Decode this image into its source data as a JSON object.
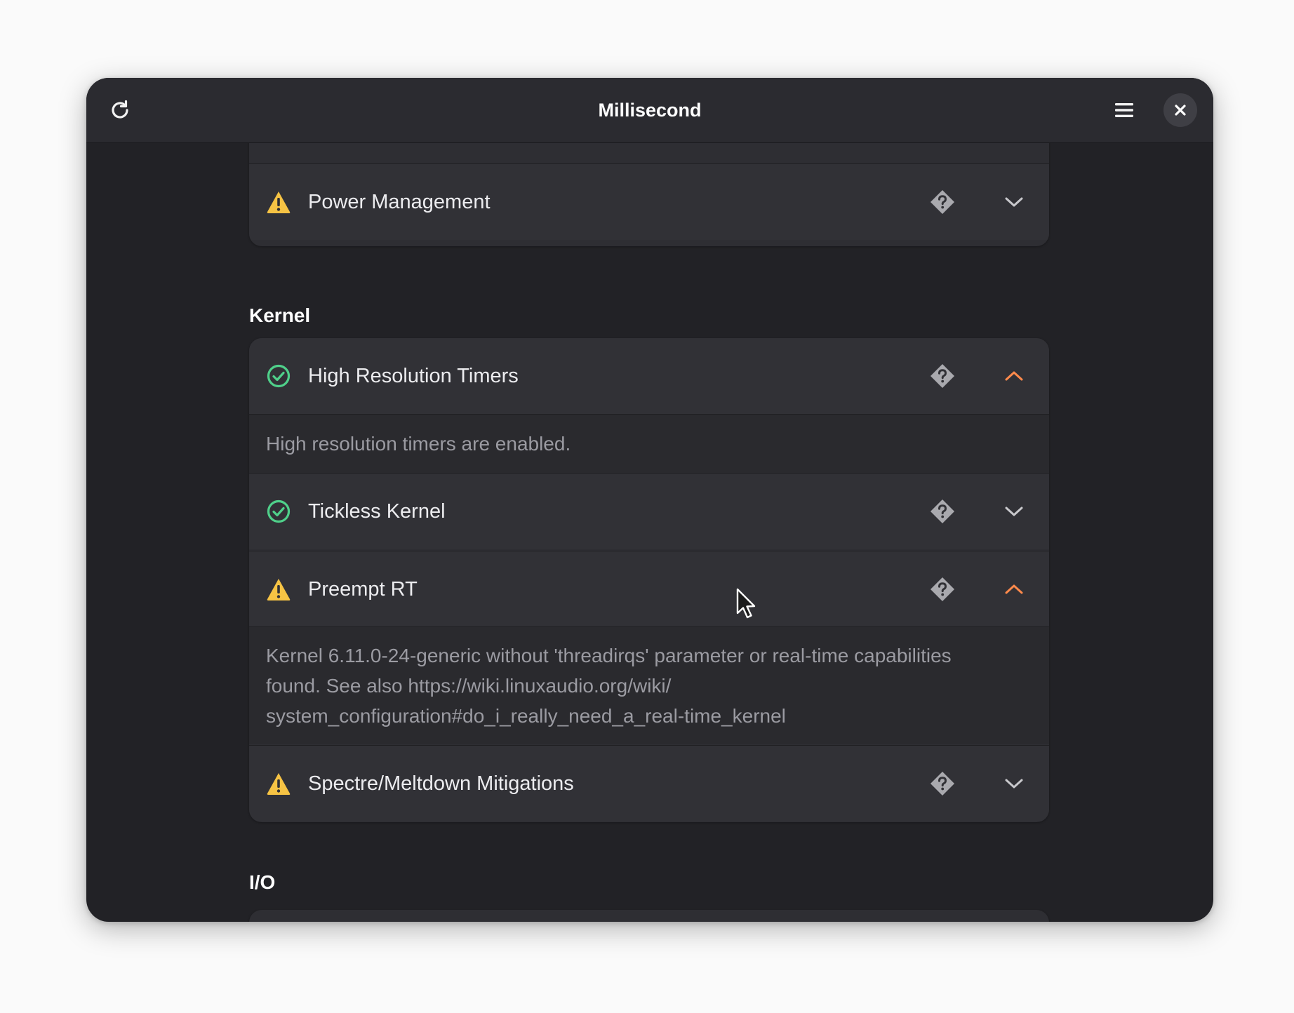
{
  "window": {
    "title": "Millisecond"
  },
  "header": {
    "refresh_icon": "refresh-icon",
    "menu_icon": "hamburger-menu-icon",
    "close_icon": "close-icon"
  },
  "colors": {
    "warning": "#f6c344",
    "success": "#4fd08a",
    "accent_chevron": "#ff8a4c",
    "help_icon": "#a9a9ae"
  },
  "sections": {
    "top": {
      "rows": [
        {
          "label": "Power Management",
          "status": "warning",
          "expanded": false
        }
      ]
    },
    "kernel": {
      "title": "Kernel",
      "rows": [
        {
          "label": "High Resolution Timers",
          "status": "ok",
          "expanded": true,
          "detail": "High resolution timers are enabled."
        },
        {
          "label": "Tickless Kernel",
          "status": "ok",
          "expanded": false
        },
        {
          "label": "Preempt RT",
          "status": "warning",
          "expanded": true,
          "detail_lines": [
            "Kernel 6.11.0-24-generic without 'threadirqs' parameter or real-time capabilities",
            "found. See also https://wiki.linuxaudio.org/wiki/",
            "system_configuration#do_i_really_need_a_real-time_kernel"
          ]
        },
        {
          "label": "Spectre/Meltdown Mitigations",
          "status": "warning",
          "expanded": false
        }
      ]
    },
    "io": {
      "title": "I/O"
    }
  }
}
